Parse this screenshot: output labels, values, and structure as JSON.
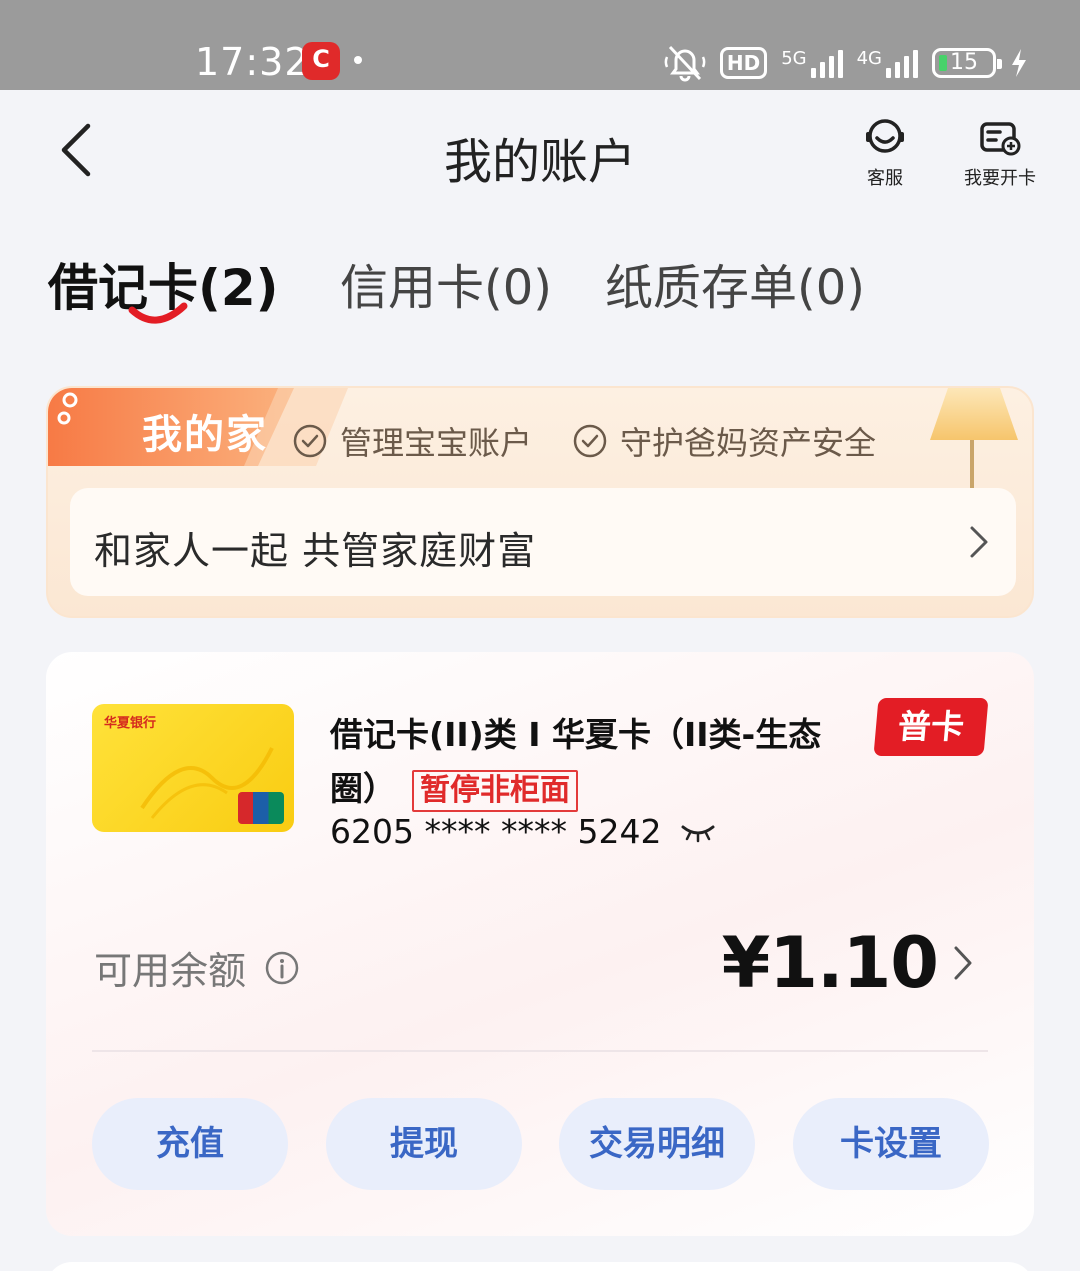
{
  "status_bar": {
    "time": "17:32",
    "app_icon_label": "C",
    "hd_label": "HD",
    "net1_label": "5G",
    "net2_label": "4G",
    "battery": "15",
    "icons": [
      "mute-icon",
      "hd-icon",
      "signal-5g-icon",
      "signal-4g-icon",
      "battery-icon",
      "charging-icon"
    ]
  },
  "header": {
    "title": "我的账户",
    "service_label": "客服",
    "open_card_label": "我要开卡"
  },
  "tabs": [
    {
      "label": "借记卡(2)",
      "active": true
    },
    {
      "label": "信用卡(0)",
      "active": false
    },
    {
      "label": "纸质存单(0)",
      "active": false
    }
  ],
  "family_banner": {
    "badge": "我的家",
    "tags": [
      "管理宝宝账户",
      "守护爸妈资产安全"
    ],
    "slogan": "和家人一起 共管家庭财富"
  },
  "account": {
    "card_image_bank_text": "华夏银行",
    "title": "借记卡(II)类 I 华夏卡（II类-生态圈）",
    "status_badge": "暂停非柜面",
    "card_number": "6205 **** **** 5242",
    "level_badge": "普卡",
    "balance_label": "可用余额",
    "balance_value": "¥1.10",
    "actions": [
      "充值",
      "提现",
      "交易明细",
      "卡设置"
    ]
  },
  "colors": {
    "accent_red": "#e31d25",
    "action_text": "#3a67c5",
    "action_bg": "#e9eefb",
    "family_orange": "#f28a55"
  }
}
